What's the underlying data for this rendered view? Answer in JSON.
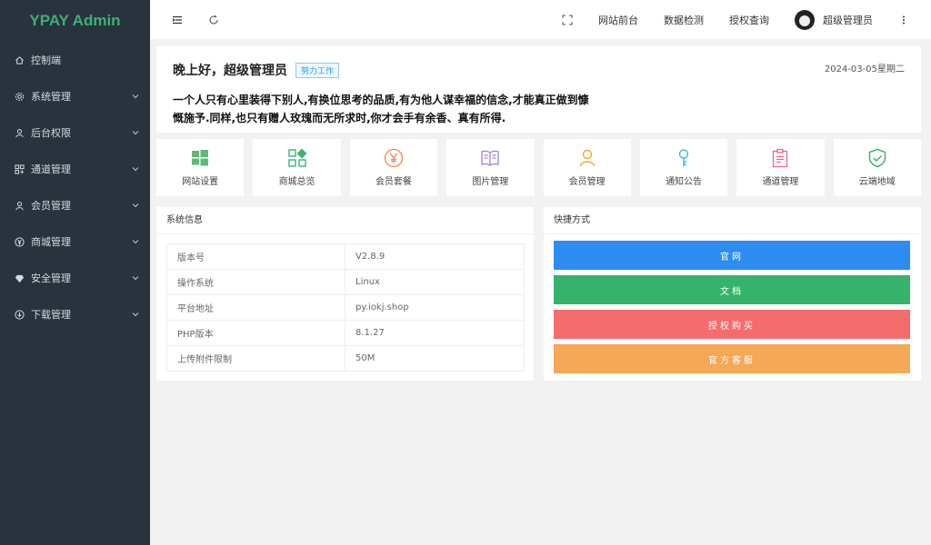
{
  "brand": "YPAY Admin",
  "sidebar": {
    "items": [
      {
        "label": "控制端",
        "icon": "home-icon"
      },
      {
        "label": "系统管理",
        "icon": "gear-icon"
      },
      {
        "label": "后台权限",
        "icon": "user-icon"
      },
      {
        "label": "通道管理",
        "icon": "grid-icon"
      },
      {
        "label": "会员管理",
        "icon": "user-icon"
      },
      {
        "label": "商城管理",
        "icon": "yen-circle-icon"
      },
      {
        "label": "安全管理",
        "icon": "diamond-icon"
      },
      {
        "label": "下载管理",
        "icon": "download-circle-icon"
      }
    ]
  },
  "header": {
    "links": [
      "网站前台",
      "数据检测",
      "授权查询"
    ],
    "user_name": "超级管理员"
  },
  "greeting": {
    "title": "晚上好，超级管理员",
    "badge": "努力工作",
    "date": "2024-03-05星期二",
    "quote": "一个人只有心里装得下别人,有换位思考的品质,有为他人谋幸福的信念,才能真正做到慷慨施予.同样,也只有赠人玫瑰而无所求时,你才会手有余香、真有所得."
  },
  "shortcuts": [
    {
      "label": "网站设置",
      "icon": "windows-icon",
      "color": "#5fb878"
    },
    {
      "label": "商城总览",
      "icon": "apps-icon",
      "color": "#3cb371"
    },
    {
      "label": "会员套餐",
      "icon": "yen-circle-icon",
      "color": "#ff7f50"
    },
    {
      "label": "图片管理",
      "icon": "book-icon",
      "color": "#a97bdb"
    },
    {
      "label": "会员管理",
      "icon": "user-icon",
      "color": "#f0a830"
    },
    {
      "label": "通知公告",
      "icon": "key-icon",
      "color": "#3cc0c0"
    },
    {
      "label": "通道管理",
      "icon": "clipboard-icon",
      "color": "#f06292"
    },
    {
      "label": "云端地域",
      "icon": "shield-check-icon",
      "color": "#3cb371"
    }
  ],
  "system_info": {
    "title": "系统信息",
    "rows": [
      {
        "key": "版本号",
        "value": "V2.8.9"
      },
      {
        "key": "操作系统",
        "value": "Linux"
      },
      {
        "key": "平台地址",
        "value": "py.iokj.shop"
      },
      {
        "key": "PHP版本",
        "value": "8.1.27"
      },
      {
        "key": "上传附件限制",
        "value": "50M"
      }
    ]
  },
  "quick_links": {
    "title": "快捷方式",
    "buttons": [
      {
        "label": "官网",
        "color": "#2d8cf0"
      },
      {
        "label": "文档",
        "color": "#36b36a"
      },
      {
        "label": "授权购买",
        "color": "#f56c6c"
      },
      {
        "label": "官方客服",
        "color": "#f5a855"
      }
    ]
  }
}
